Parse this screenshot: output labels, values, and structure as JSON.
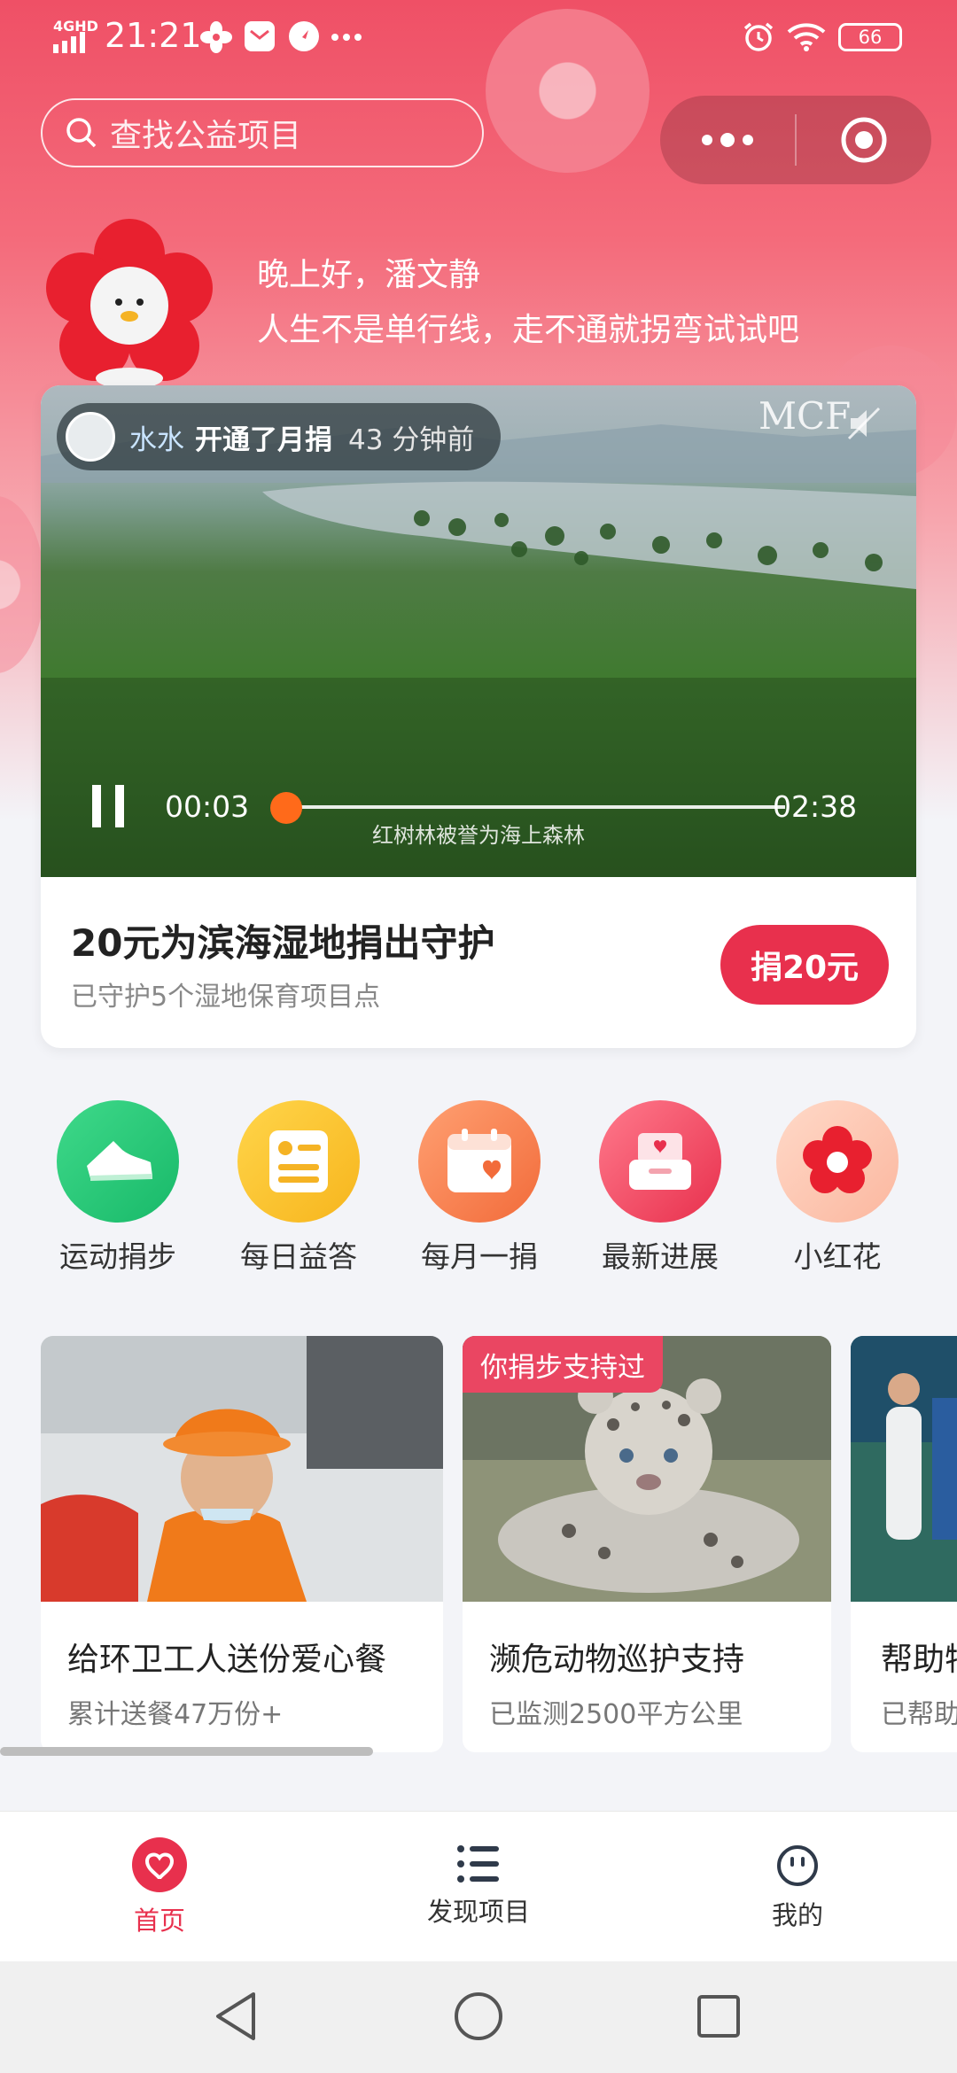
{
  "status_bar": {
    "network": "4GHD",
    "time": "21:21",
    "battery": "66",
    "icons": [
      "pinwheel-icon",
      "mail-icon",
      "compass-icon",
      "more-dots-icon",
      "alarm-icon",
      "wifi-icon",
      "battery-icon"
    ]
  },
  "search": {
    "placeholder": "查找公益项目"
  },
  "capsule": {
    "icons": [
      "more-dots-icon",
      "target-icon"
    ]
  },
  "greeting": {
    "line1": "晚上好，潘文静",
    "line2": "人生不是单行线，走不通就拐弯试试吧"
  },
  "hero_card": {
    "activity": {
      "name": "水水",
      "action": "开通了月捐",
      "time": "43 分钟前"
    },
    "watermark": "MCF",
    "video": {
      "current_time": "00:03",
      "duration": "02:38",
      "progress": 0.02,
      "caption": "红树林被誉为海上森林"
    },
    "title": "20元为滨海湿地捐出守护",
    "subtitle": "已守护5个湿地保育项目点",
    "donate_label": "捐20元"
  },
  "quick_actions": [
    {
      "label": "运动捐步",
      "icon": "sneaker-icon"
    },
    {
      "label": "每日益答",
      "icon": "quiz-card-icon"
    },
    {
      "label": "每月一捐",
      "icon": "calendar-heart-icon"
    },
    {
      "label": "最新进展",
      "icon": "inbox-heart-icon"
    },
    {
      "label": "小红花",
      "icon": "red-flower-icon"
    }
  ],
  "projects": [
    {
      "title": "给环卫工人送份爱心餐",
      "subtitle": "累计送餐47万份+",
      "tag": ""
    },
    {
      "title": "濒危动物巡护支持",
      "subtitle": "已监测2500平方公里",
      "tag": "你捐步支持过"
    },
    {
      "title": "帮助特",
      "subtitle": "已帮助",
      "tag": ""
    }
  ],
  "scroll_progress": 0.39,
  "tab_bar": {
    "items": [
      {
        "label": "首页",
        "icon": "heart-home-icon",
        "active": true
      },
      {
        "label": "发现项目",
        "icon": "list-icon",
        "active": false
      },
      {
        "label": "我的",
        "icon": "smiley-icon",
        "active": false
      }
    ],
    "active_color": "#e8304d",
    "inactive_color": "#333333"
  },
  "colors": {
    "brand_red": "#e8304d",
    "hero_gradient_top": "#ef5066",
    "progress_knob": "#ff6a1a"
  }
}
